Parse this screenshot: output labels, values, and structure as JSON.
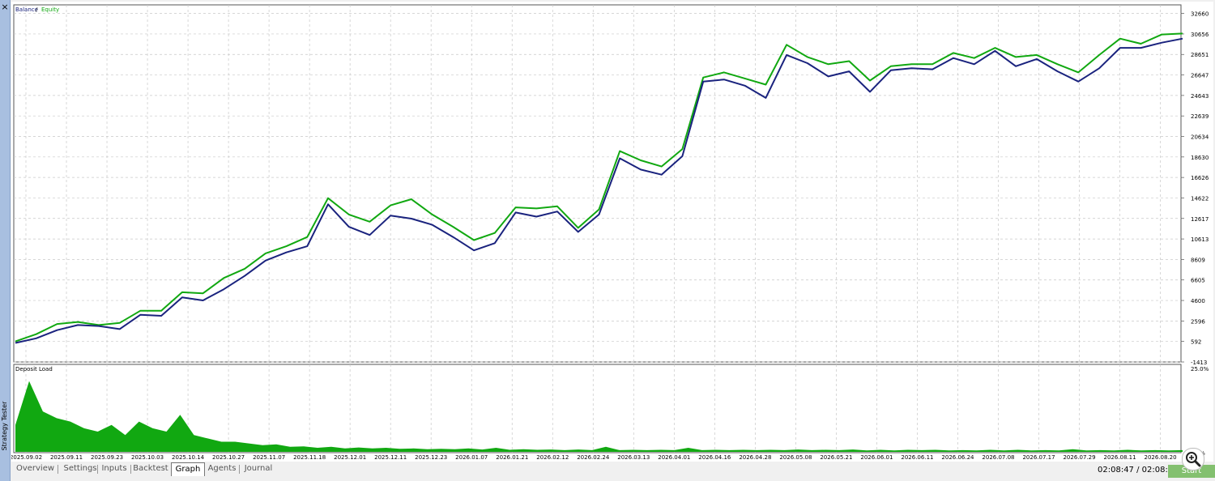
{
  "window": {
    "close_label": "×",
    "side_label": "Strategy Tester"
  },
  "chart_data": [
    {
      "type": "line",
      "title": "",
      "legend": [
        {
          "name": "Balance",
          "color": "#1a237e"
        },
        {
          "name": "Equity",
          "color": "#11a811"
        }
      ],
      "legend_sep": " / ",
      "ylim": [
        -1413,
        33500
      ],
      "y_ticks": [
        32660,
        30656,
        28651,
        26647,
        24643,
        22639,
        20634,
        18630,
        16626,
        14622,
        12617,
        10613,
        8609,
        6605,
        4600,
        2596,
        592,
        -1413
      ],
      "x_ticks": [
        "2025.09.02",
        "2025.09.11",
        "2025.09.23",
        "2025.10.03",
        "2025.10.14",
        "2025.10.27",
        "2025.11.07",
        "2025.11.18",
        "2025.12.01",
        "2025.12.11",
        "2025.12.23",
        "2026.01.07",
        "2026.01.21",
        "2026.02.12",
        "2026.02.24",
        "2026.03.13",
        "2026.04.01",
        "2026.04.16",
        "2026.04.28",
        "2026.05.08",
        "2026.05.21",
        "2026.06.01",
        "2026.06.11",
        "2026.06.24",
        "2026.07.08",
        "2026.07.17",
        "2026.07.29",
        "2026.08.11",
        "2026.08.20"
      ],
      "series": [
        {
          "name": "Balance",
          "values": [
            450,
            900,
            1700,
            2200,
            2100,
            1800,
            3200,
            3100,
            4900,
            4600,
            5700,
            7000,
            8500,
            9300,
            9900,
            14000,
            11800,
            11000,
            12900,
            12600,
            12000,
            10800,
            9500,
            10200,
            13200,
            12800,
            13300,
            11300,
            13000,
            18500,
            17400,
            16900,
            18700,
            26000,
            26200,
            25600,
            24400,
            28600,
            27800,
            26500,
            27000,
            25000,
            27100,
            27300,
            27200,
            28300,
            27700,
            29000,
            27500,
            28200,
            27000,
            26000,
            27300,
            29300,
            29300,
            29800,
            30200
          ]
        },
        {
          "name": "Equity",
          "values": [
            600,
            1300,
            2300,
            2500,
            2200,
            2400,
            3600,
            3600,
            5400,
            5300,
            6800,
            7700,
            9200,
            9900,
            10800,
            14600,
            13000,
            12300,
            13900,
            14500,
            13000,
            11800,
            10500,
            11200,
            13700,
            13600,
            13800,
            11700,
            13500,
            19200,
            18300,
            17700,
            19400,
            26400,
            26900,
            26300,
            25700,
            29600,
            28400,
            27700,
            28000,
            26100,
            27500,
            27700,
            27700,
            28800,
            28300,
            29300,
            28400,
            28600,
            27700,
            26900,
            28600,
            30200,
            29700,
            30600,
            30700
          ]
        }
      ]
    },
    {
      "type": "area",
      "title": "Deposit Load",
      "ylim": [
        0,
        25
      ],
      "y_ticks": [
        "25.0%",
        "0.0%"
      ],
      "series": [
        {
          "name": "Deposit Load",
          "values": [
            8,
            21,
            12,
            10,
            9,
            7,
            6,
            8,
            5,
            9,
            7,
            6,
            11,
            5,
            4,
            3,
            3,
            2.5,
            2,
            2.2,
            1.5,
            1.6,
            1.2,
            1.5,
            1,
            1.3,
            1,
            1.2,
            0.9,
            1,
            0.8,
            0.9,
            0.8,
            1,
            0.7,
            1.2,
            0.6,
            0.8,
            0.6,
            0.7,
            0.5,
            0.7,
            0.5,
            1.5,
            0.5,
            0.6,
            0.5,
            0.6,
            0.5,
            1.2,
            0.5,
            0.6,
            0.5,
            0.6,
            0.5,
            0.6,
            0.5,
            0.7,
            0.5,
            0.6,
            0.5,
            0.7,
            0.4,
            0.6,
            0.4,
            0.6,
            0.5,
            0.6,
            0.4,
            0.5,
            0.4,
            0.6,
            0.4,
            0.6,
            0.4,
            0.5,
            0.4,
            0.8,
            0.4,
            0.5,
            0.4,
            0.6,
            0.4,
            0.5,
            0.4,
            0.5
          ]
        }
      ]
    }
  ],
  "tabs": [
    "Overview",
    "Settings",
    "Inputs",
    "Backtest",
    "Graph",
    "Agents",
    "Journal"
  ],
  "active_tab": "Graph",
  "status": {
    "time": "02:08:47 / 02:08:54",
    "start_label": "Start"
  }
}
